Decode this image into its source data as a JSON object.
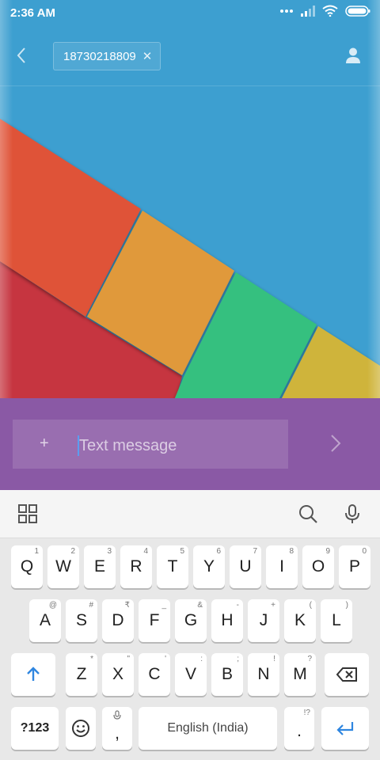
{
  "status_bar": {
    "time": "2:36 AM"
  },
  "header": {
    "back_icon": "chevron-left-icon",
    "recipient": "18730218809",
    "remove_icon": "close-icon",
    "contact_icon": "person-icon"
  },
  "compose": {
    "attach_label": "+",
    "placeholder": "Text message",
    "send_icon": "chevron-right-icon"
  },
  "keyboard_toolbar": {
    "menu_icon": "grid-icon",
    "search_icon": "search-icon",
    "mic_icon": "microphone-icon"
  },
  "keyboard": {
    "row1": [
      {
        "label": "Q",
        "hint": "1"
      },
      {
        "label": "W",
        "hint": "2"
      },
      {
        "label": "E",
        "hint": "3"
      },
      {
        "label": "R",
        "hint": "4"
      },
      {
        "label": "T",
        "hint": "5"
      },
      {
        "label": "Y",
        "hint": "6"
      },
      {
        "label": "U",
        "hint": "7"
      },
      {
        "label": "I",
        "hint": "8"
      },
      {
        "label": "O",
        "hint": "9"
      },
      {
        "label": "P",
        "hint": "0"
      }
    ],
    "row2": [
      {
        "label": "A",
        "hint": "@"
      },
      {
        "label": "S",
        "hint": "#"
      },
      {
        "label": "D",
        "hint": "₹"
      },
      {
        "label": "F",
        "hint": "_"
      },
      {
        "label": "G",
        "hint": "&"
      },
      {
        "label": "H",
        "hint": "-"
      },
      {
        "label": "J",
        "hint": "+"
      },
      {
        "label": "K",
        "hint": "("
      },
      {
        "label": "L",
        "hint": ")"
      }
    ],
    "row3": [
      {
        "label": "Z",
        "hint": "*"
      },
      {
        "label": "X",
        "hint": "\""
      },
      {
        "label": "C",
        "hint": "'"
      },
      {
        "label": "V",
        "hint": ":"
      },
      {
        "label": "B",
        "hint": ";"
      },
      {
        "label": "N",
        "hint": "!"
      },
      {
        "label": "M",
        "hint": "?"
      }
    ],
    "shift_icon": "shift-arrow-icon",
    "backspace_icon": "backspace-icon",
    "symbols_label": "?123",
    "emoji_icon": "smiley-icon",
    "comma_label": ",",
    "space_label": "English (India)",
    "period_label": ".",
    "period_hint": "!?",
    "enter_icon": "enter-arrow-icon"
  }
}
